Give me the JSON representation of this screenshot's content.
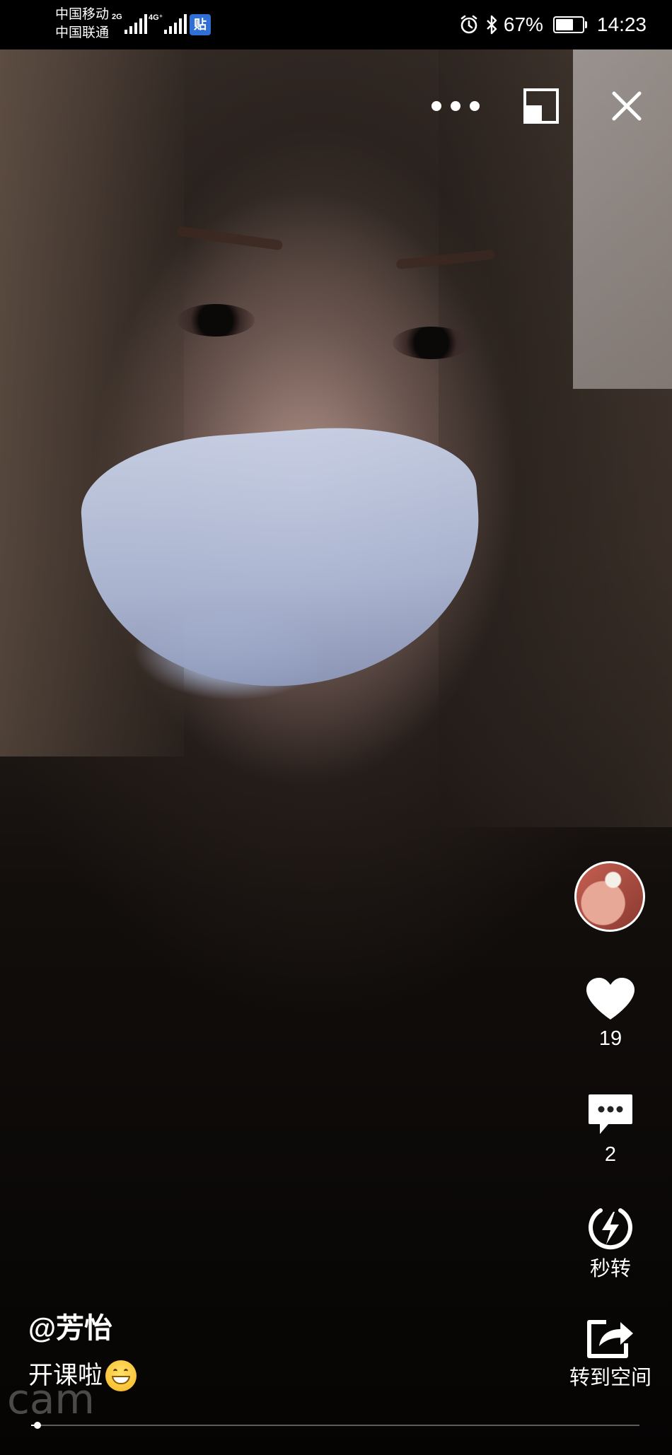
{
  "status_bar": {
    "carrier_1": "中国移动",
    "carrier_2": "中国联通",
    "network_1": "2G",
    "network_2": "4G⁺",
    "app_badge": "贴",
    "battery_percent": "67%",
    "battery_level": 0.67,
    "time": "14:23",
    "icons": [
      "alarm-icon",
      "bluetooth-icon",
      "battery-icon"
    ]
  },
  "top_controls": {
    "icons": [
      "more-icon",
      "window-icon",
      "close-icon"
    ]
  },
  "actions": {
    "likes": "19",
    "comments": "2",
    "quick_forward": "秒转",
    "share_to_space": "转到空间"
  },
  "post": {
    "author": "@芳怡",
    "caption": "开课啦",
    "watermark": "cam"
  },
  "playback": {
    "progress": 0.01
  },
  "colors": {
    "background": "#000000",
    "text": "#ffffff",
    "badge": "#2f6fd6"
  }
}
